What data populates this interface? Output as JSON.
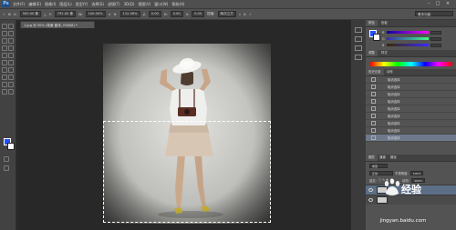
{
  "app": {
    "logo_text": "Ps"
  },
  "menu": [
    "文件(F)",
    "编辑(E)",
    "图像(I)",
    "图层(L)",
    "类型(Y)",
    "选择(S)",
    "滤镜(T)",
    "3D(D)",
    "视图(V)",
    "窗口(W)",
    "帮助(H)"
  ],
  "window_controls": [
    "–",
    "□",
    "×"
  ],
  "options_bar": {
    "x_label": "X:",
    "x_value": "500.00 像",
    "y_label": "Y:",
    "y_value": "792.00 像",
    "w_label": "W:",
    "w_value": "100.00%",
    "h_label": "H:",
    "h_value": "112.36%",
    "angle_value": "0.00",
    "h2_label": "H:",
    "h2_value": "0.00",
    "v_label": "V:",
    "v_value": "0.00",
    "interp_value": "两次立方"
  },
  "workspace": "基本功能",
  "document_tab": "1.jpg @ 50% (背景 副本, RGB/8) *",
  "panels": {
    "color_tabs": [
      "颜色",
      "色板"
    ],
    "adjust_tabs": [
      "调整",
      "样式"
    ],
    "history_tabs": [
      "历史记录",
      "动作"
    ],
    "sliders": [
      {
        "label": "R",
        "value": ""
      },
      {
        "label": "G",
        "value": ""
      },
      {
        "label": "B",
        "value": ""
      }
    ],
    "history_items": [
      "取消选择",
      "取消选择",
      "取消选择",
      "取消选择",
      "取消选择",
      "取消选择",
      "取消选择",
      "取消选择",
      "取消选择"
    ],
    "layers_tabs": [
      "图层",
      "通道",
      "路径"
    ],
    "layers_kind": "类型",
    "blend_mode": "正常",
    "opacity_label": "不透明度:",
    "opacity_value": "100%",
    "lock_label": "锁定:",
    "fill_label": "填充:",
    "fill_value": "100%"
  },
  "watermark": {
    "text": "Baidu 经验",
    "url": "jingyan.baidu.com"
  },
  "colors": {
    "foreground": "#2350ff",
    "background": "#ffffff",
    "selection_highlight": "#6e7a8c"
  }
}
